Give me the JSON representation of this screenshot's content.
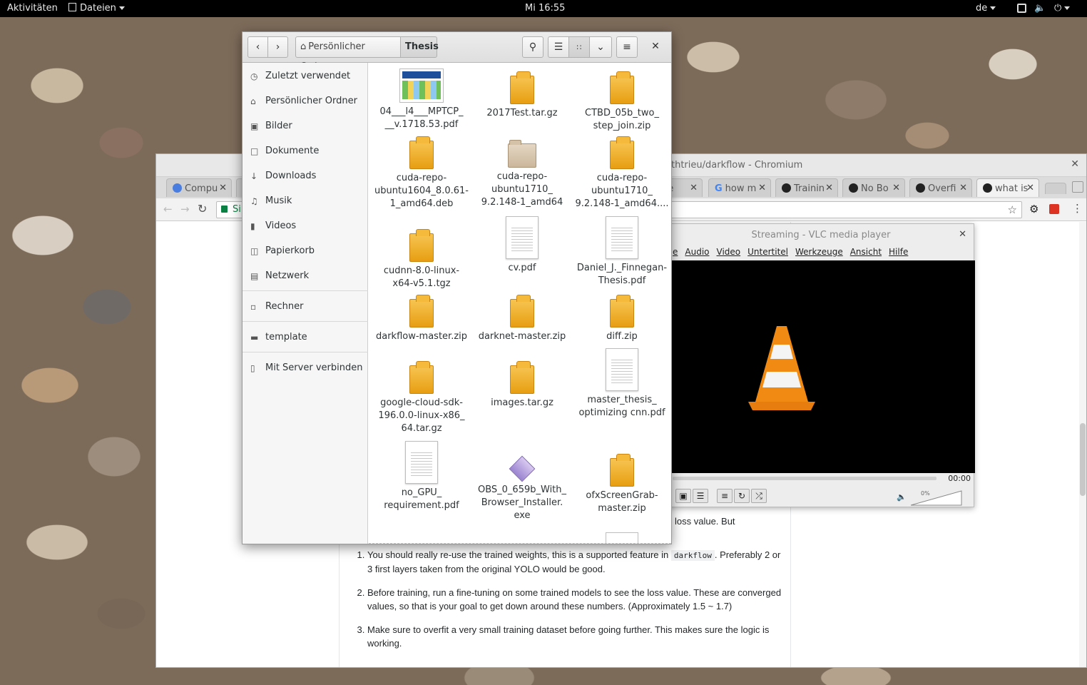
{
  "topbar": {
    "activities": "Aktivitäten",
    "app_menu": "Dateien",
    "clock": "Mi 16:55",
    "lang": "de"
  },
  "chromium": {
    "title": "thtrieu/darkflow - Chromium",
    "tabs": [
      "Compu",
      "ge",
      "how m",
      "Trainin",
      "No Bo",
      "Overfi",
      "what is"
    ],
    "omni_partial": "Si",
    "answer_partial": "loss value. But",
    "list": [
      {
        "before": "You should really re-use the trained weights, this is a supported feature in ",
        "code": "darkflow",
        "after": ". Preferably 2 or 3 first layers taken from the original YOLO would be good."
      },
      {
        "text": "Before training, run a fine-tuning on some trained models to see the loss value. These are converged values, so that is your goal to get down around these numbers. (Approximately 1.5 ~ 1.7)"
      },
      {
        "text": "Make sure to overfit a very small training dataset before going further. This makes sure the logic is working."
      }
    ]
  },
  "vlc": {
    "title": "Streaming - VLC media player",
    "menu": [
      "e",
      "Audio",
      "Video",
      "Untertitel",
      "Werkzeuge",
      "Ansicht",
      "Hilfe"
    ],
    "time": "00:00",
    "volume": "0%"
  },
  "files": {
    "breadcrumb": {
      "home": "Persönlicher Ordner",
      "current": "Thesis"
    },
    "sidebar": [
      "Zuletzt verwendet",
      "Persönlicher Ordner",
      "Bilder",
      "Dokumente",
      "Downloads",
      "Musik",
      "Videos",
      "Papierkorb",
      "Netzwerk",
      "Rechner",
      "template",
      "Mit Server verbinden"
    ],
    "items": [
      {
        "name": "04___l4___MPTCP_\n__v.1718.53.pdf",
        "kind": "thumb"
      },
      {
        "name": "2017Test.tar.gz",
        "kind": "pkg"
      },
      {
        "name": "CTBD_05b_two_\nstep_join.zip",
        "kind": "pkg"
      },
      {
        "name": "cuda-repo-\nubuntu1604_8.0.61-\n1_amd64.deb",
        "kind": "pkg"
      },
      {
        "name": "cuda-repo-\nubuntu1710_\n9.2.148-1_amd64",
        "kind": "folder"
      },
      {
        "name": "cuda-repo-\nubuntu1710_\n9.2.148-1_amd64....",
        "kind": "pkg"
      },
      {
        "name": "cudnn-8.0-linux-\nx64-v5.1.tgz",
        "kind": "pkg"
      },
      {
        "name": "cv.pdf",
        "kind": "doc"
      },
      {
        "name": "Daniel_J._Finnegan-\nThesis.pdf",
        "kind": "doc"
      },
      {
        "name": "darkflow-master.zip",
        "kind": "pkg"
      },
      {
        "name": "darknet-master.zip",
        "kind": "pkg"
      },
      {
        "name": "diff.zip",
        "kind": "pkg"
      },
      {
        "name": "google-cloud-sdk-\n196.0.0-linux-x86_\n64.tar.gz",
        "kind": "pkg"
      },
      {
        "name": "images.tar.gz",
        "kind": "pkg"
      },
      {
        "name": "master_thesis_\noptimizing cnn.pdf",
        "kind": "doc"
      },
      {
        "name": "no_GPU_\nrequirement.pdf",
        "kind": "doc"
      },
      {
        "name": "OBS_0_659b_With_\nBrowser_Installer.\nexe",
        "kind": "exe"
      },
      {
        "name": "ofxScreenGrab-\nmaster.zip",
        "kind": "pkg"
      }
    ]
  }
}
